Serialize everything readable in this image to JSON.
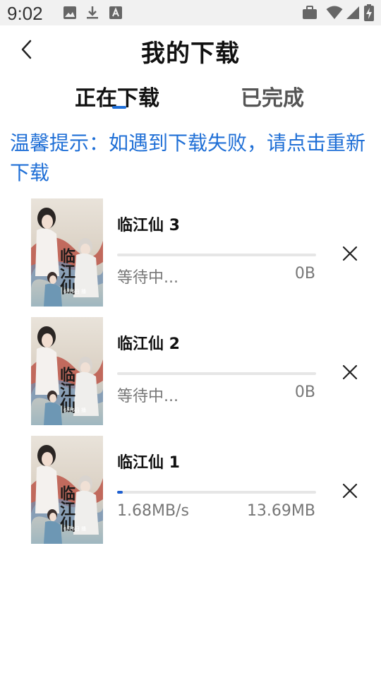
{
  "status_bar": {
    "time": "9:02",
    "left_icons": [
      "image-icon",
      "download-arrow-icon",
      "font-a-icon"
    ],
    "right_icons": [
      "briefcase-icon",
      "wifi-icon",
      "signal-icon",
      "battery-charging-icon"
    ]
  },
  "header": {
    "title": "我的下载",
    "back_icon": "chevron-left-icon"
  },
  "tabs": [
    {
      "label": "正在下载",
      "active": true
    },
    {
      "label": "已完成",
      "active": false
    }
  ],
  "tip": "温馨提示：如遇到下载失败，请点击重新下载",
  "colors": {
    "accent": "#1e6fd9",
    "tip_text": "#1f6fd6",
    "status_bar_bg": "#f1f1f1"
  },
  "downloads": [
    {
      "name": "临江仙 3",
      "status": "等待中...",
      "size": "0B",
      "progress": 0
    },
    {
      "name": "临江仙 2",
      "status": "等待中...",
      "size": "0B",
      "progress": 0
    },
    {
      "name": "临江仙 1",
      "status": "1.68MB/s",
      "size": "13.69MB",
      "progress": 0.03
    }
  ],
  "poster": {
    "title_text": "临江仙",
    "date_text": "6月6日 播"
  }
}
